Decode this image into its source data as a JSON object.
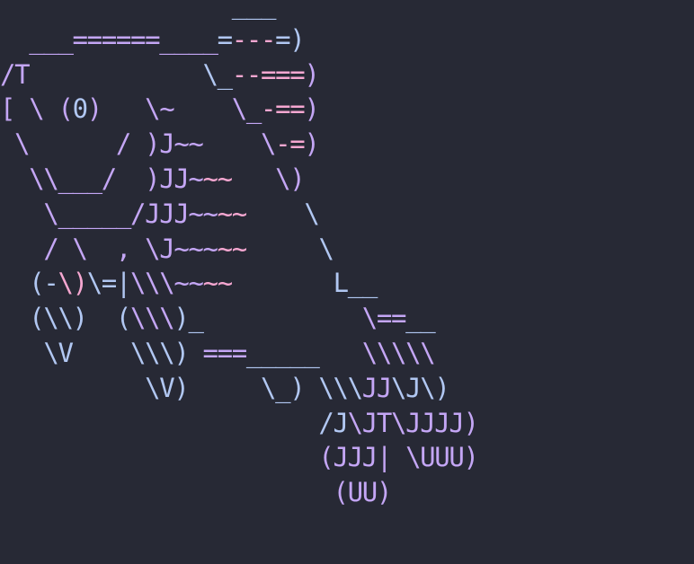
{
  "palette": {
    "background": "#272935",
    "blue": "#b1c7f2",
    "violet": "#c4a6f5",
    "pink": "#f6a7d1"
  },
  "art_lines": [
    [
      {
        "t": "                ___",
        "c": "blue"
      }
    ],
    [
      {
        "t": "  ___======____",
        "c": "violet"
      },
      {
        "t": "=",
        "c": "blue"
      },
      {
        "t": "---",
        "c": "pink"
      },
      {
        "t": "=)",
        "c": "blue"
      }
    ],
    [
      {
        "t": "/T",
        "c": "violet"
      },
      {
        "t": "            \\_",
        "c": "blue"
      },
      {
        "t": "--===",
        "c": "pink"
      },
      {
        "t": ")",
        "c": "violet"
      }
    ],
    [
      {
        "t": "[ \\ (",
        "c": "violet"
      },
      {
        "t": "0",
        "c": "blue"
      },
      {
        "t": ")   \\~    \\_",
        "c": "violet"
      },
      {
        "t": "-==",
        "c": "pink"
      },
      {
        "t": ")",
        "c": "violet"
      }
    ],
    [
      {
        "t": " \\      / )J~~    \\",
        "c": "violet"
      },
      {
        "t": "-=",
        "c": "pink"
      },
      {
        "t": ")",
        "c": "violet"
      }
    ],
    [
      {
        "t": "  \\\\___/  )JJ~",
        "c": "violet"
      },
      {
        "t": "~~",
        "c": "pink"
      },
      {
        "t": "   \\)",
        "c": "violet"
      }
    ],
    [
      {
        "t": "   \\_____/JJJ~~",
        "c": "violet"
      },
      {
        "t": "~~",
        "c": "pink"
      },
      {
        "t": "    \\",
        "c": "blue"
      }
    ],
    [
      {
        "t": "   / \\  , \\J~~~",
        "c": "violet"
      },
      {
        "t": "~~",
        "c": "pink"
      },
      {
        "t": "     \\",
        "c": "blue"
      }
    ],
    [
      {
        "t": "  (-",
        "c": "blue"
      },
      {
        "t": "\\)",
        "c": "pink"
      },
      {
        "t": "\\=|",
        "c": "blue"
      },
      {
        "t": "\\\\\\~~",
        "c": "violet"
      },
      {
        "t": "~~",
        "c": "pink"
      },
      {
        "t": "       L__",
        "c": "blue"
      }
    ],
    [
      {
        "t": "  (\\\\)  (",
        "c": "blue"
      },
      {
        "t": "\\\\\\",
        "c": "violet"
      },
      {
        "t": ")_",
        "c": "blue"
      },
      {
        "t": "           \\==",
        "c": "violet"
      },
      {
        "t": "__",
        "c": "blue"
      }
    ],
    [
      {
        "t": "   \\V    \\\\\\) ",
        "c": "blue"
      },
      {
        "t": "===",
        "c": "violet"
      },
      {
        "t": "_____",
        "c": "blue"
      },
      {
        "t": "   \\\\\\\\\\",
        "c": "violet"
      }
    ],
    [
      {
        "t": "          \\V)     \\_) \\\\\\",
        "c": "blue"
      },
      {
        "t": "JJ",
        "c": "violet"
      },
      {
        "t": "\\J\\)",
        "c": "blue"
      }
    ],
    [
      {
        "t": "                      /J",
        "c": "blue"
      },
      {
        "t": "\\JT\\JJJJ)",
        "c": "violet"
      }
    ],
    [
      {
        "t": "                      (JJJ| \\UUU)",
        "c": "violet"
      }
    ],
    [
      {
        "t": "                       (UU)",
        "c": "violet"
      }
    ]
  ]
}
